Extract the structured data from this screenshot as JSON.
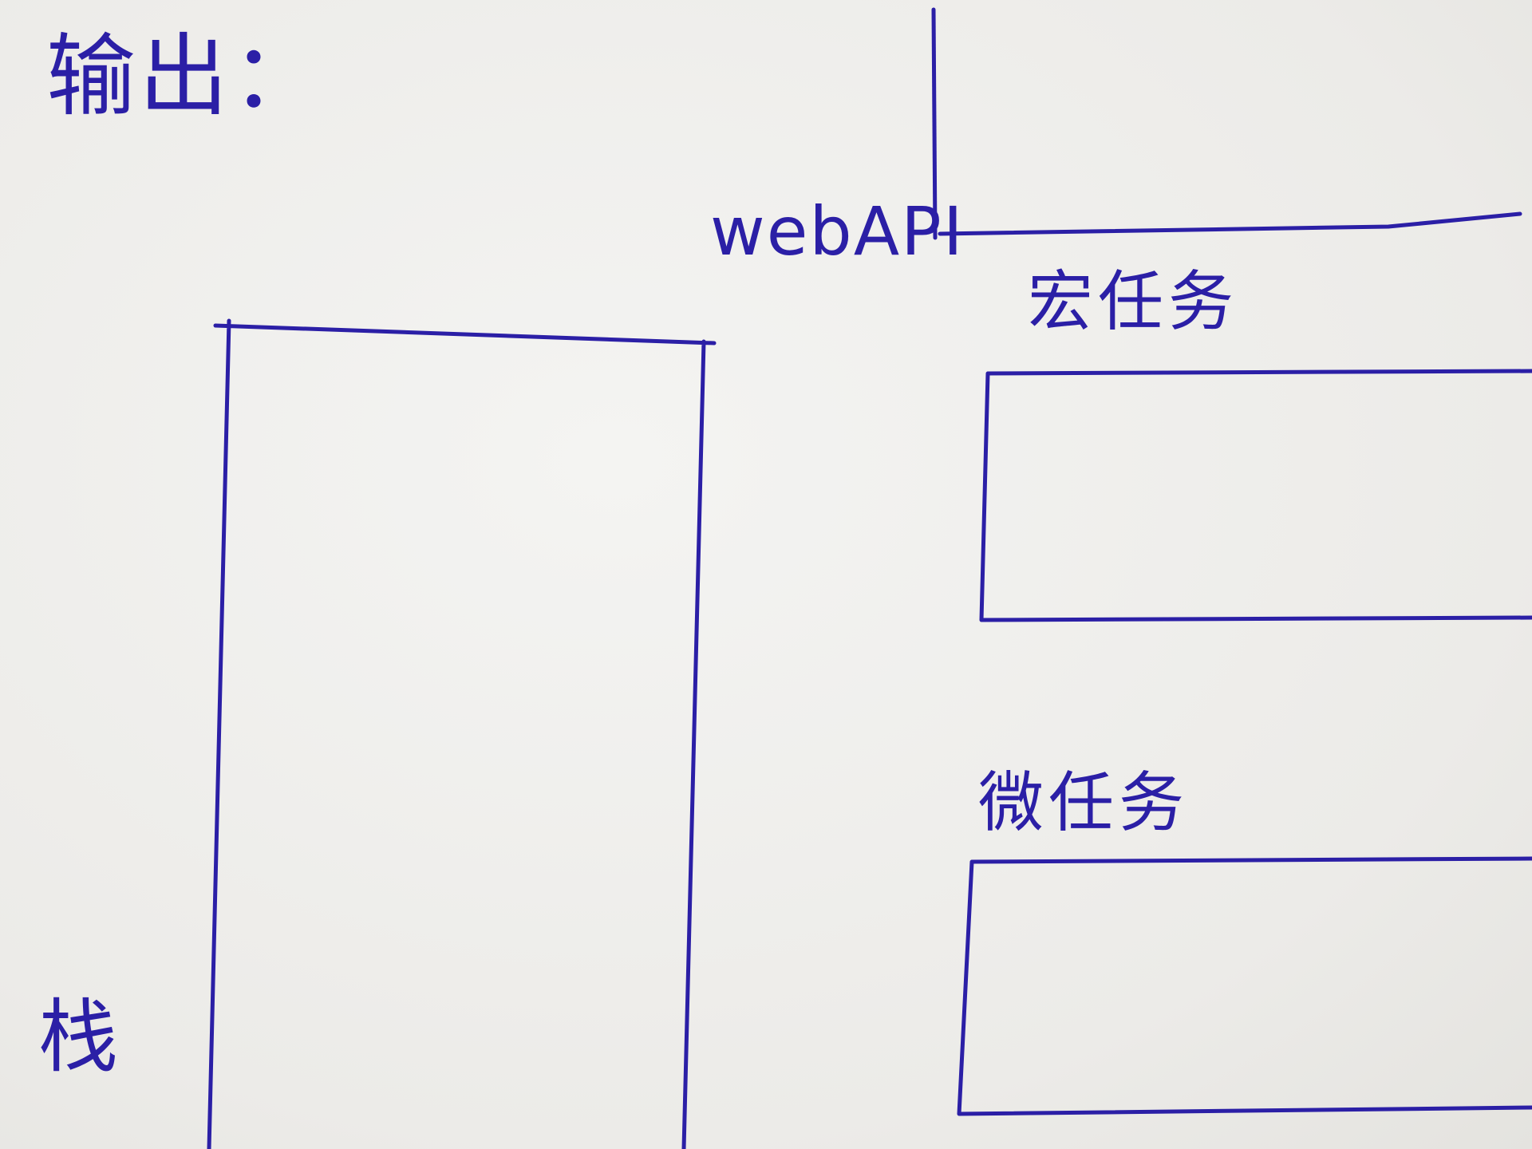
{
  "labels": {
    "title": "输出：",
    "web_api": "webAPI",
    "macro_task": "宏任务",
    "micro_task": "微任务",
    "stack": "栈"
  },
  "colors": {
    "ink": "#2b1fa6",
    "paper": "#efefed"
  }
}
